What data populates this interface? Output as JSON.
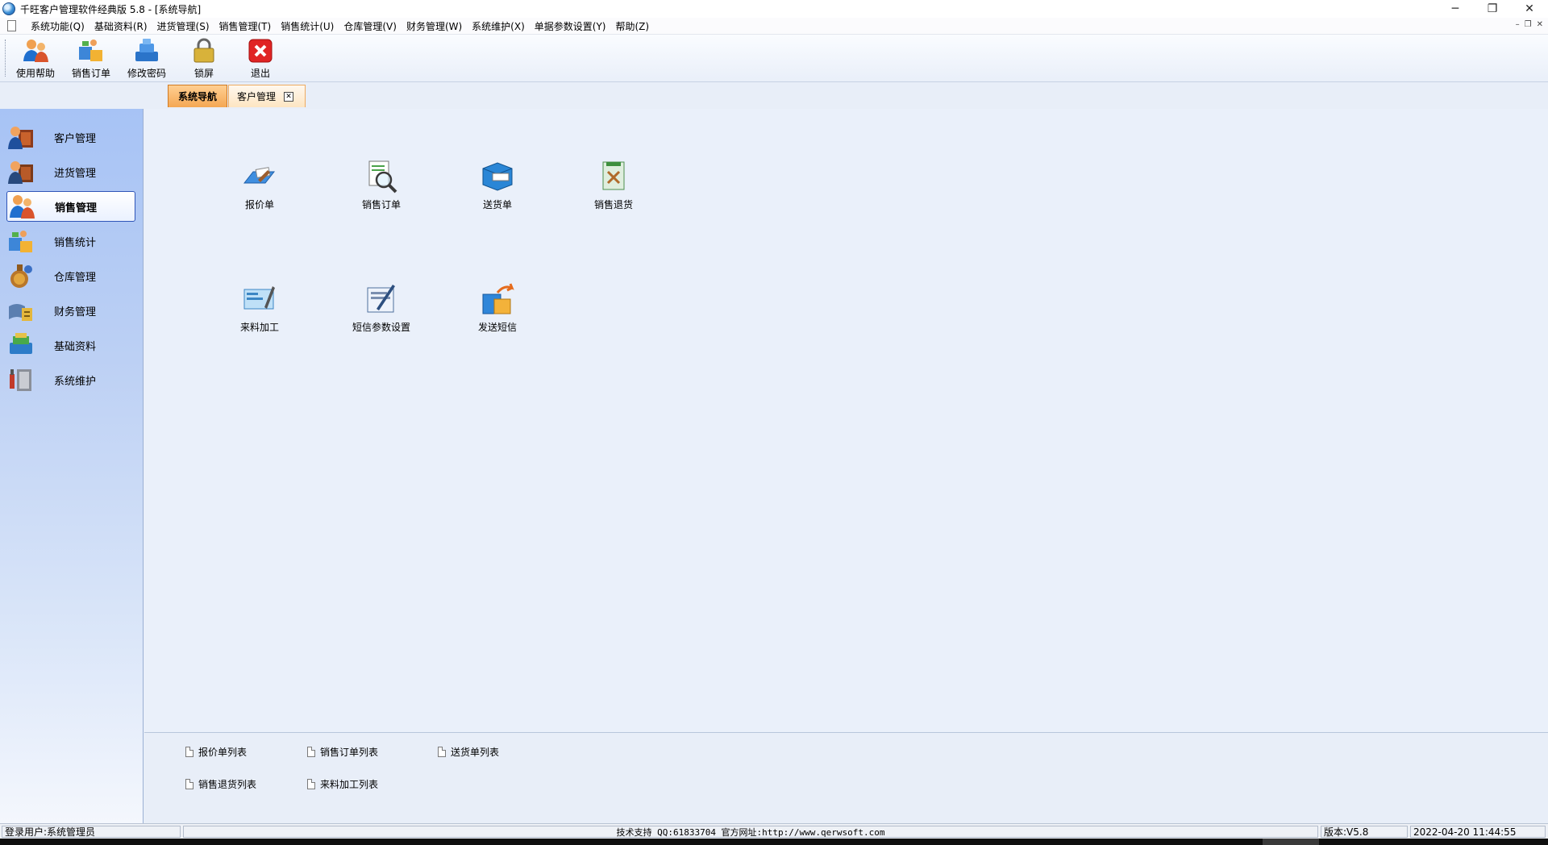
{
  "window": {
    "title": "千旺客户管理软件经典版 5.8 - [系统导航]",
    "minimize": "─",
    "restore": "❐",
    "close": "✕"
  },
  "menubar": {
    "items": [
      "系统功能(Q)",
      "基础资料(R)",
      "进货管理(S)",
      "销售管理(T)",
      "销售统计(U)",
      "仓库管理(V)",
      "财务管理(W)",
      "系统维护(X)",
      "单据参数设置(Y)",
      "帮助(Z)"
    ],
    "mdi_minimize": "–",
    "mdi_restore": "❐",
    "mdi_close": "✕"
  },
  "toolbar": {
    "buttons": [
      {
        "label": "使用帮助",
        "icon": "help-user-icon"
      },
      {
        "label": "销售订单",
        "icon": "sales-order-icon"
      },
      {
        "label": "修改密码",
        "icon": "change-password-icon"
      },
      {
        "label": "锁屏",
        "icon": "lock-icon"
      },
      {
        "label": "退出",
        "icon": "exit-icon"
      }
    ]
  },
  "tabs": {
    "active": "系统导航",
    "second": "客户管理",
    "close": "✕"
  },
  "sidebar": {
    "items": [
      {
        "label": "客户管理",
        "icon": "customer-icon"
      },
      {
        "label": "进货管理",
        "icon": "purchase-icon"
      },
      {
        "label": "销售管理",
        "icon": "sales-icon",
        "active": true
      },
      {
        "label": "销售统计",
        "icon": "sales-stats-icon"
      },
      {
        "label": "仓库管理",
        "icon": "warehouse-icon"
      },
      {
        "label": "财务管理",
        "icon": "finance-icon"
      },
      {
        "label": "基础资料",
        "icon": "basic-data-icon"
      },
      {
        "label": "系统维护",
        "icon": "system-maintenance-icon"
      }
    ]
  },
  "main": {
    "nav_items": [
      {
        "label": "报价单",
        "icon": "quotation-icon"
      },
      {
        "label": "销售订单",
        "icon": "sales-order-search-icon"
      },
      {
        "label": "送货单",
        "icon": "delivery-note-icon"
      },
      {
        "label": "销售退货",
        "icon": "sales-return-icon"
      },
      {
        "label": "来料加工",
        "icon": "processing-icon"
      },
      {
        "label": "短信参数设置",
        "icon": "sms-settings-icon"
      },
      {
        "label": "发送短信",
        "icon": "send-sms-icon"
      }
    ],
    "links": [
      "报价单列表",
      "销售订单列表",
      "送货单列表",
      "销售退货列表",
      "来料加工列表"
    ]
  },
  "status": {
    "user": "登录用户:系统管理员",
    "support": "技术支持 QQ:61833704 官方网址:http://www.qerwsoft.com",
    "version": "版本:V5.8",
    "datetime": "2022-04-20 11:44:55"
  },
  "colors": {
    "accent_tab": "#f4a753",
    "sidebar_top": "#a7c3f5",
    "content_bg": "#eaf0fa",
    "active_border": "#2f55b8"
  }
}
